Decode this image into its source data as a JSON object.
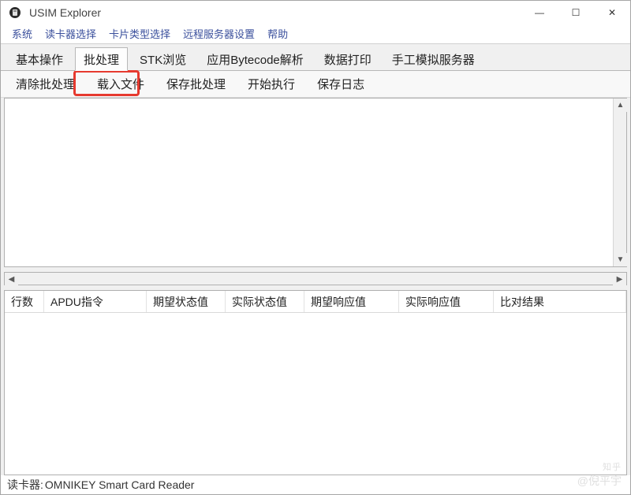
{
  "app": {
    "title": "USIM Explorer"
  },
  "window_controls": {
    "minimize": "—",
    "maximize": "☐",
    "close": "✕"
  },
  "menubar": {
    "items": [
      "系统",
      "读卡器选择",
      "卡片类型选择",
      "远程服务器设置",
      "帮助"
    ]
  },
  "tabs": {
    "items": [
      {
        "label": "基本操作",
        "active": false
      },
      {
        "label": "批处理",
        "active": true
      },
      {
        "label": "STK浏览",
        "active": false
      },
      {
        "label": "应用Bytecode解析",
        "active": false
      },
      {
        "label": "数据打印",
        "active": false
      },
      {
        "label": "手工模拟服务器",
        "active": false
      }
    ]
  },
  "toolbar": {
    "buttons": [
      "清除批处理",
      "载入文件",
      "保存批处理",
      "开始执行",
      "保存日志"
    ],
    "highlight_index": 1
  },
  "table": {
    "columns": [
      {
        "label": "行数",
        "width": 50
      },
      {
        "label": "APDU指令",
        "width": 130
      },
      {
        "label": "期望状态值",
        "width": 100
      },
      {
        "label": "实际状态值",
        "width": 100
      },
      {
        "label": "期望响应值",
        "width": 120
      },
      {
        "label": "实际响应值",
        "width": 120
      },
      {
        "label": "比对结果",
        "width": 120
      }
    ],
    "rows": []
  },
  "statusbar": {
    "label": "读卡器:",
    "value": "OMNIKEY Smart Card Reader"
  },
  "watermark": {
    "line1": "知乎",
    "line2": "@倪平宇"
  }
}
